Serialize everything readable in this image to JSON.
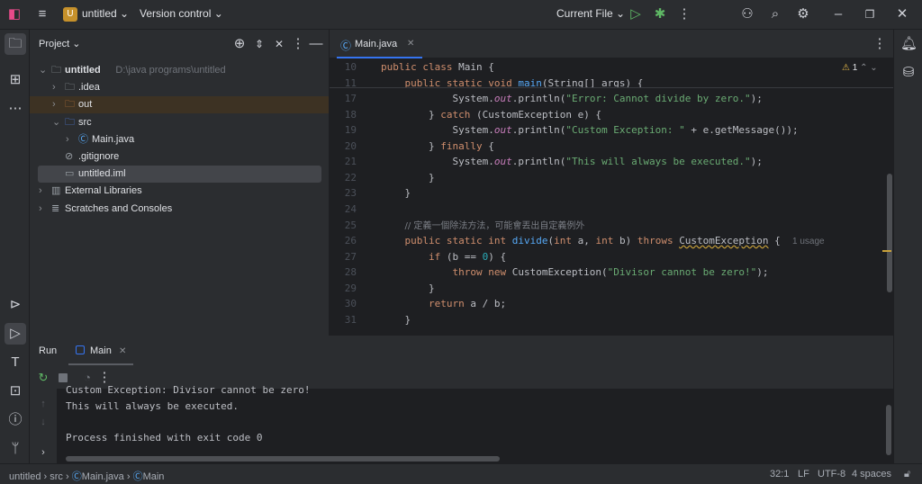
{
  "topbar": {
    "project_badge": "U",
    "project": "untitled",
    "vcs": "Version control",
    "run_config": "Current File"
  },
  "project_panel": {
    "title": "Project",
    "tree": [
      {
        "label": "untitled",
        "path": "D:\\java programs\\untitled",
        "indent": 0,
        "arrow": "⌄",
        "icon": "module-folder-icon"
      },
      {
        "label": ".idea",
        "indent": 1,
        "arrow": "›",
        "icon": "folder-icon"
      },
      {
        "label": "out",
        "indent": 1,
        "arrow": "›",
        "icon": "excluded-folder-icon"
      },
      {
        "label": "src",
        "indent": 1,
        "arrow": "⌄",
        "icon": "source-folder-icon"
      },
      {
        "label": "Main.java",
        "indent": 2,
        "arrow": "›",
        "icon": "java-class-icon"
      },
      {
        "label": ".gitignore",
        "indent": 1,
        "arrow": "",
        "icon": "ignore-file-icon"
      },
      {
        "label": "untitled.iml",
        "indent": 1,
        "arrow": "",
        "icon": "iml-file-icon",
        "selected": true
      },
      {
        "label": "External Libraries",
        "indent": 0,
        "arrow": "›",
        "icon": "libraries-icon"
      },
      {
        "label": "Scratches and Consoles",
        "indent": 0,
        "arrow": "›",
        "icon": "scratches-icon"
      }
    ]
  },
  "editor": {
    "tab": "Main.java",
    "warnings": "1",
    "lines": [
      {
        "n": "10",
        "t": [
          [
            "public class ",
            "kw"
          ],
          [
            "Main {",
            ""
          ]
        ]
      },
      {
        "n": "11",
        "t": [
          [
            "    public static void ",
            "kw"
          ],
          [
            "main",
            "fn"
          ],
          [
            "(String[] args) {",
            ""
          ]
        ]
      },
      {
        "n": "17",
        "t": [
          [
            "            System.",
            ""
          ],
          [
            "out",
            "fld"
          ],
          [
            ".println(",
            ""
          ],
          [
            "\"Error: Cannot divide by zero.\"",
            "st"
          ],
          [
            ");",
            ""
          ]
        ]
      },
      {
        "n": "18",
        "t": [
          [
            "        } ",
            ""
          ],
          [
            "catch ",
            "kw"
          ],
          [
            "(CustomException e) {",
            ""
          ]
        ]
      },
      {
        "n": "19",
        "t": [
          [
            "            System.",
            ""
          ],
          [
            "out",
            "fld"
          ],
          [
            ".println(",
            ""
          ],
          [
            "\"Custom Exception: \"",
            "st"
          ],
          [
            " + e.getMessage());",
            ""
          ]
        ]
      },
      {
        "n": "20",
        "t": [
          [
            "        } ",
            ""
          ],
          [
            "finally ",
            "kw"
          ],
          [
            "{",
            ""
          ]
        ]
      },
      {
        "n": "21",
        "t": [
          [
            "            System.",
            ""
          ],
          [
            "out",
            "fld"
          ],
          [
            ".println(",
            ""
          ],
          [
            "\"This will always be executed.\"",
            "st"
          ],
          [
            ");",
            ""
          ]
        ]
      },
      {
        "n": "22",
        "t": [
          [
            "        }",
            ""
          ]
        ]
      },
      {
        "n": "23",
        "t": [
          [
            "    }",
            ""
          ]
        ]
      },
      {
        "n": "24",
        "t": []
      },
      {
        "n": "25",
        "t": [
          [
            "    ",
            ""
          ],
          [
            "// 定義一個除法方法，可能會丟出自定義例外",
            "cm"
          ]
        ]
      },
      {
        "n": "26",
        "t": [
          [
            "    public static int ",
            "kw"
          ],
          [
            "divide",
            "fn"
          ],
          [
            "(",
            ""
          ],
          [
            "int ",
            "kw"
          ],
          [
            "a, ",
            ""
          ],
          [
            "int ",
            "kw"
          ],
          [
            "b) ",
            ""
          ],
          [
            "throws ",
            "kw"
          ],
          [
            "CustomException",
            "un"
          ],
          [
            " {  ",
            ""
          ],
          [
            "1 usage",
            "hint"
          ]
        ]
      },
      {
        "n": "27",
        "t": [
          [
            "        if ",
            "kw"
          ],
          [
            "(b == ",
            ""
          ],
          [
            "0",
            "num"
          ],
          [
            ") {",
            ""
          ]
        ]
      },
      {
        "n": "28",
        "t": [
          [
            "            throw new ",
            "kw"
          ],
          [
            "CustomException(",
            ""
          ],
          [
            "\"Divisor cannot be zero!\"",
            "st"
          ],
          [
            ");",
            ""
          ]
        ]
      },
      {
        "n": "29",
        "t": [
          [
            "        }",
            ""
          ]
        ]
      },
      {
        "n": "30",
        "t": [
          [
            "        return ",
            "kw"
          ],
          [
            "a / b;",
            ""
          ]
        ]
      },
      {
        "n": "31",
        "t": [
          [
            "    }",
            ""
          ]
        ]
      }
    ]
  },
  "run_panel": {
    "title": "Run",
    "tab": "Main",
    "output": [
      "Custom Exception: Divisor cannot be zero!",
      "This will always be executed.",
      "",
      "Process finished with exit code 0"
    ]
  },
  "status": {
    "crumbs": [
      "untitled",
      "src",
      "Main.java",
      "Main"
    ],
    "position": "32:1",
    "line_sep": "LF",
    "encoding": "UTF-8",
    "indent": "4 spaces"
  }
}
